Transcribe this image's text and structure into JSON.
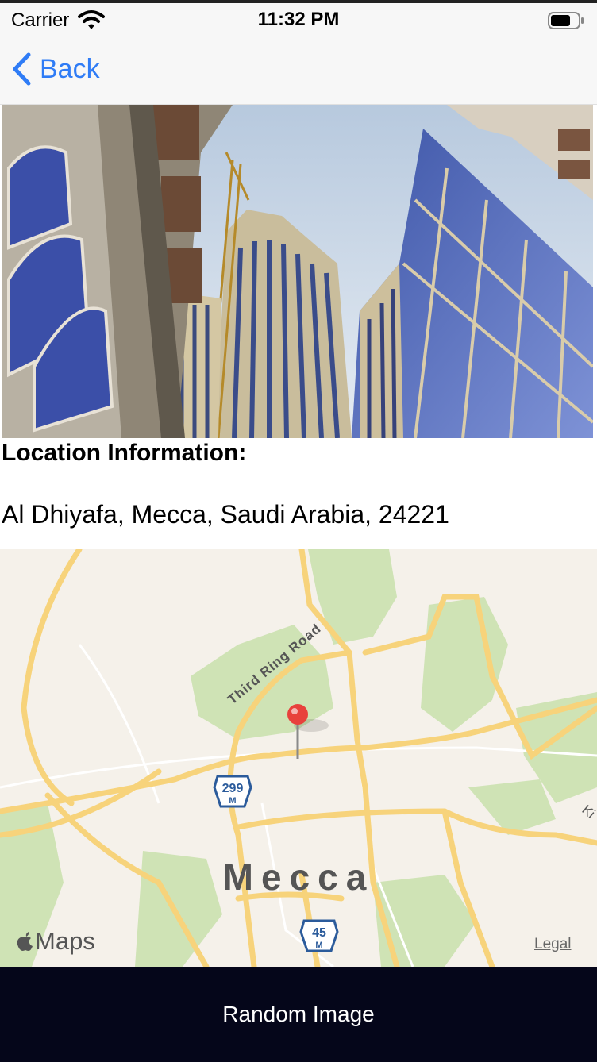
{
  "status_bar": {
    "carrier": "Carrier",
    "time": "11:32 PM"
  },
  "nav": {
    "back_label": "Back",
    "accent_color": "#2f7cf6"
  },
  "location": {
    "heading": "Location Information:",
    "address": "Al Dhiyafa, Mecca, Saudi Arabia, 24221"
  },
  "map": {
    "city_label": "Mecca",
    "road_label": "Third Ring Road",
    "highway_shields": [
      "299",
      "45"
    ],
    "shield_suffix": "M",
    "edge_label": "Ki",
    "maps_brand": "Maps",
    "legal_link": "Legal",
    "pin_color": "#e8413c"
  },
  "footer": {
    "button_label": "Random Image",
    "background": "#05061a"
  }
}
